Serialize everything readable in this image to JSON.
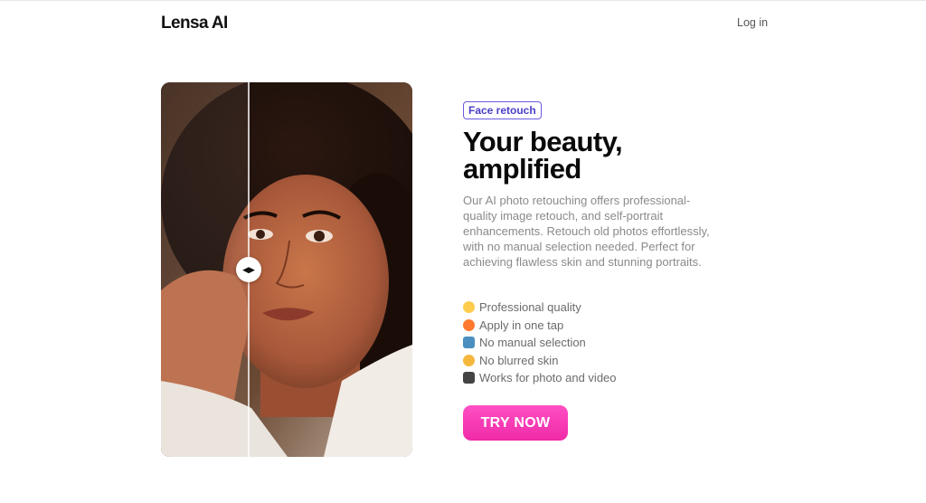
{
  "header": {
    "logo": "Lensa AI",
    "login_label": "Log in"
  },
  "hero": {
    "badge": "Face retouch",
    "headline_line1": "Your beauty,",
    "headline_line2": "amplified",
    "description": "Our AI photo retouching offers professional-quality image retouch, and self-portrait enhancements. Retouch old photos effortlessly, with no manual selection needed. Perfect for achieving flawless skin and stunning portraits.",
    "features": [
      {
        "icon": "sunglasses-emoji-icon",
        "label": "Professional quality"
      },
      {
        "icon": "fire-emoji-icon",
        "label": "Apply in one tap"
      },
      {
        "icon": "robot-emoji-icon",
        "label": "No manual selection"
      },
      {
        "icon": "princess-emoji-icon",
        "label": "No blurred skin"
      },
      {
        "icon": "video-camera-emoji-icon",
        "label": "Works for photo and video"
      }
    ],
    "cta_label": "TRY NOW"
  },
  "comparison": {
    "slider_position": 0.35,
    "handle_left_glyph": "◀",
    "handle_right_glyph": "▶"
  },
  "colors": {
    "badge_border": "#6a5ae0",
    "cta_gradient_start": "#ff4fc4",
    "cta_gradient_end": "#f02aa8",
    "description_text": "#8a8a8a"
  }
}
